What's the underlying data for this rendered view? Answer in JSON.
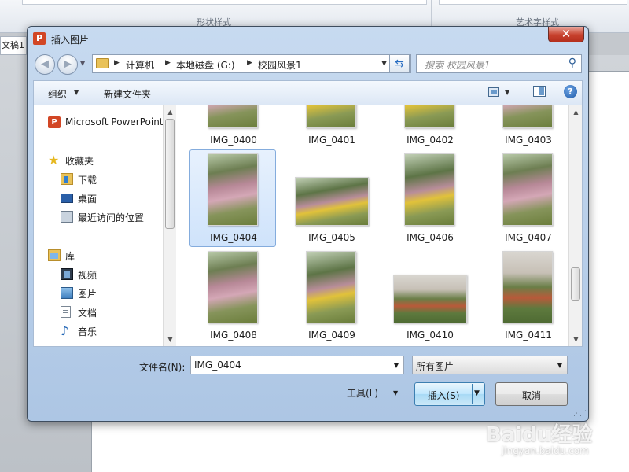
{
  "background": {
    "ribbon_groups": [
      "形状样式",
      "艺术字样式"
    ],
    "doc_tab": "文稿1"
  },
  "dialog": {
    "title": "插入图片",
    "app_icon": "P",
    "close_label": "✕",
    "breadcrumb": [
      "计算机",
      "本地磁盘 (G:)",
      "校园风景1"
    ],
    "search_placeholder": "搜索 校园风景1",
    "toolbar": {
      "organize": "组织",
      "new_folder": "新建文件夹"
    },
    "nav_items": [
      {
        "label": "Microsoft PowerPoint",
        "icon": "powerpoint-icon",
        "level": 0
      },
      {
        "label": "收藏夹",
        "icon": "star-icon",
        "level": 0
      },
      {
        "label": "下载",
        "icon": "download-folder-icon",
        "level": 1
      },
      {
        "label": "桌面",
        "icon": "desktop-icon",
        "level": 1
      },
      {
        "label": "最近访问的位置",
        "icon": "recent-places-icon",
        "level": 1
      },
      {
        "label": "库",
        "icon": "library-icon",
        "level": 0
      },
      {
        "label": "视频",
        "icon": "video-icon",
        "level": 1
      },
      {
        "label": "图片",
        "icon": "pictures-icon",
        "level": 1
      },
      {
        "label": "文档",
        "icon": "documents-icon",
        "level": 1
      },
      {
        "label": "音乐",
        "icon": "music-icon",
        "level": 1
      }
    ],
    "files": [
      {
        "name": "IMG_0400",
        "orientation": "portrait"
      },
      {
        "name": "IMG_0401",
        "orientation": "portrait"
      },
      {
        "name": "IMG_0402",
        "orientation": "portrait"
      },
      {
        "name": "IMG_0403",
        "orientation": "portrait"
      },
      {
        "name": "IMG_0404",
        "orientation": "portrait",
        "selected": true
      },
      {
        "name": "IMG_0405",
        "orientation": "landscape"
      },
      {
        "name": "IMG_0406",
        "orientation": "portrait"
      },
      {
        "name": "IMG_0407",
        "orientation": "portrait"
      },
      {
        "name": "IMG_0408",
        "orientation": "portrait"
      },
      {
        "name": "IMG_0409",
        "orientation": "portrait"
      },
      {
        "name": "IMG_0410",
        "orientation": "landscape"
      },
      {
        "name": "IMG_0411",
        "orientation": "portrait"
      }
    ],
    "filename_label": "文件名(N):",
    "filename_value": "IMG_0404",
    "filetype_value": "所有图片",
    "tools_label": "工具(L)",
    "insert_label": "插入(S)",
    "cancel_label": "取消"
  },
  "watermark": {
    "brand": "Baidu经验",
    "url": "jingyan.baidu.com"
  }
}
